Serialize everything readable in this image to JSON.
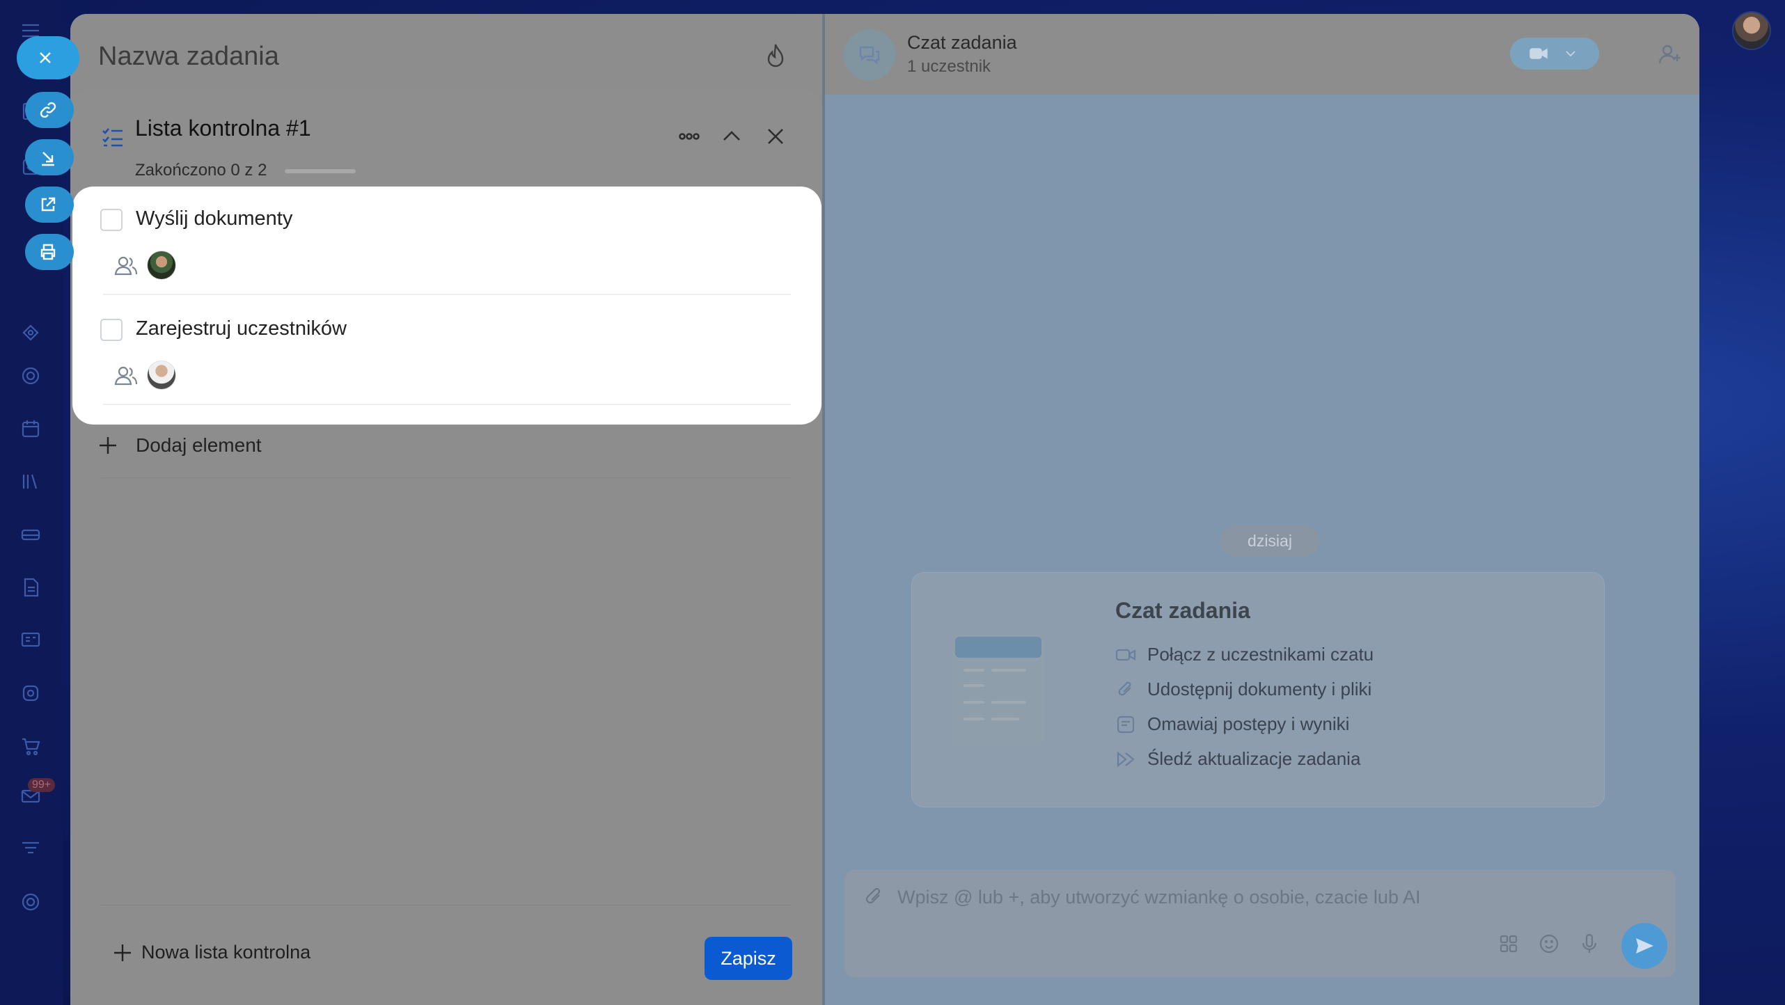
{
  "task": {
    "title": "Nazwa zadania"
  },
  "checklist": {
    "title": "Lista kontrolna #1",
    "progress_text": "Zakończono 0 z 2",
    "progress_fraction": 0,
    "items": [
      {
        "label": "Wyślij dokumenty",
        "checked": false
      },
      {
        "label": "Zarejestruj uczestników",
        "checked": false
      }
    ],
    "add_item_label": "Dodaj element",
    "new_checklist_label": "Nowa lista kontrolna",
    "save_label": "Zapisz"
  },
  "chat": {
    "title": "Czat zadania",
    "subtitle": "1 uczestnik",
    "date_label": "dzisiaj",
    "card": {
      "title": "Czat zadania",
      "features": [
        {
          "icon": "video-icon",
          "text": "Połącz z uczestnikami czatu"
        },
        {
          "icon": "paperclip-icon",
          "text": "Udostępnij dokumenty i pliki"
        },
        {
          "icon": "message-icon",
          "text": "Omawiaj postępy i wyniki"
        },
        {
          "icon": "forward-icon",
          "text": "Śledź aktualizacje zadania"
        }
      ]
    },
    "composer_placeholder": "Wpisz @ lub +, aby utworzyć wzmiankę o osobie, czacie lub AI"
  },
  "sidebar": {
    "badge": "99+"
  },
  "colors": {
    "accent": "#0a5ad1",
    "fab": "#2b9fe0",
    "checklist_icon": "#1f4fb0"
  }
}
